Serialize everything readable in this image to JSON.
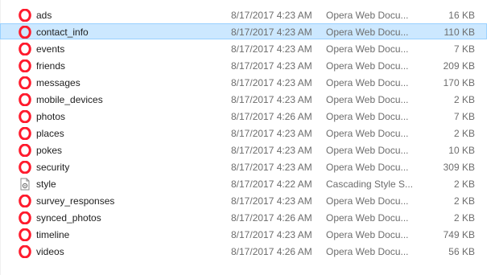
{
  "colors": {
    "opera_red": "#ff1b2d",
    "selection_bg": "#cce8ff",
    "selection_border": "#99d1ff"
  },
  "files": [
    {
      "name": "ads",
      "date": "8/17/2017 4:23 AM",
      "type": "Opera Web Docu...",
      "size": "16 KB",
      "icon": "opera-icon"
    },
    {
      "name": "contact_info",
      "date": "8/17/2017 4:23 AM",
      "type": "Opera Web Docu...",
      "size": "110 KB",
      "icon": "opera-icon",
      "selected": true
    },
    {
      "name": "events",
      "date": "8/17/2017 4:23 AM",
      "type": "Opera Web Docu...",
      "size": "7 KB",
      "icon": "opera-icon"
    },
    {
      "name": "friends",
      "date": "8/17/2017 4:23 AM",
      "type": "Opera Web Docu...",
      "size": "209 KB",
      "icon": "opera-icon"
    },
    {
      "name": "messages",
      "date": "8/17/2017 4:23 AM",
      "type": "Opera Web Docu...",
      "size": "170 KB",
      "icon": "opera-icon"
    },
    {
      "name": "mobile_devices",
      "date": "8/17/2017 4:23 AM",
      "type": "Opera Web Docu...",
      "size": "2 KB",
      "icon": "opera-icon"
    },
    {
      "name": "photos",
      "date": "8/17/2017 4:26 AM",
      "type": "Opera Web Docu...",
      "size": "7 KB",
      "icon": "opera-icon"
    },
    {
      "name": "places",
      "date": "8/17/2017 4:23 AM",
      "type": "Opera Web Docu...",
      "size": "2 KB",
      "icon": "opera-icon"
    },
    {
      "name": "pokes",
      "date": "8/17/2017 4:23 AM",
      "type": "Opera Web Docu...",
      "size": "10 KB",
      "icon": "opera-icon"
    },
    {
      "name": "security",
      "date": "8/17/2017 4:23 AM",
      "type": "Opera Web Docu...",
      "size": "309 KB",
      "icon": "opera-icon"
    },
    {
      "name": "style",
      "date": "8/17/2017 4:22 AM",
      "type": "Cascading Style S...",
      "size": "2 KB",
      "icon": "css-file-icon"
    },
    {
      "name": "survey_responses",
      "date": "8/17/2017 4:23 AM",
      "type": "Opera Web Docu...",
      "size": "2 KB",
      "icon": "opera-icon"
    },
    {
      "name": "synced_photos",
      "date": "8/17/2017 4:26 AM",
      "type": "Opera Web Docu...",
      "size": "2 KB",
      "icon": "opera-icon"
    },
    {
      "name": "timeline",
      "date": "8/17/2017 4:23 AM",
      "type": "Opera Web Docu...",
      "size": "749 KB",
      "icon": "opera-icon"
    },
    {
      "name": "videos",
      "date": "8/17/2017 4:26 AM",
      "type": "Opera Web Docu...",
      "size": "56 KB",
      "icon": "opera-icon"
    }
  ]
}
